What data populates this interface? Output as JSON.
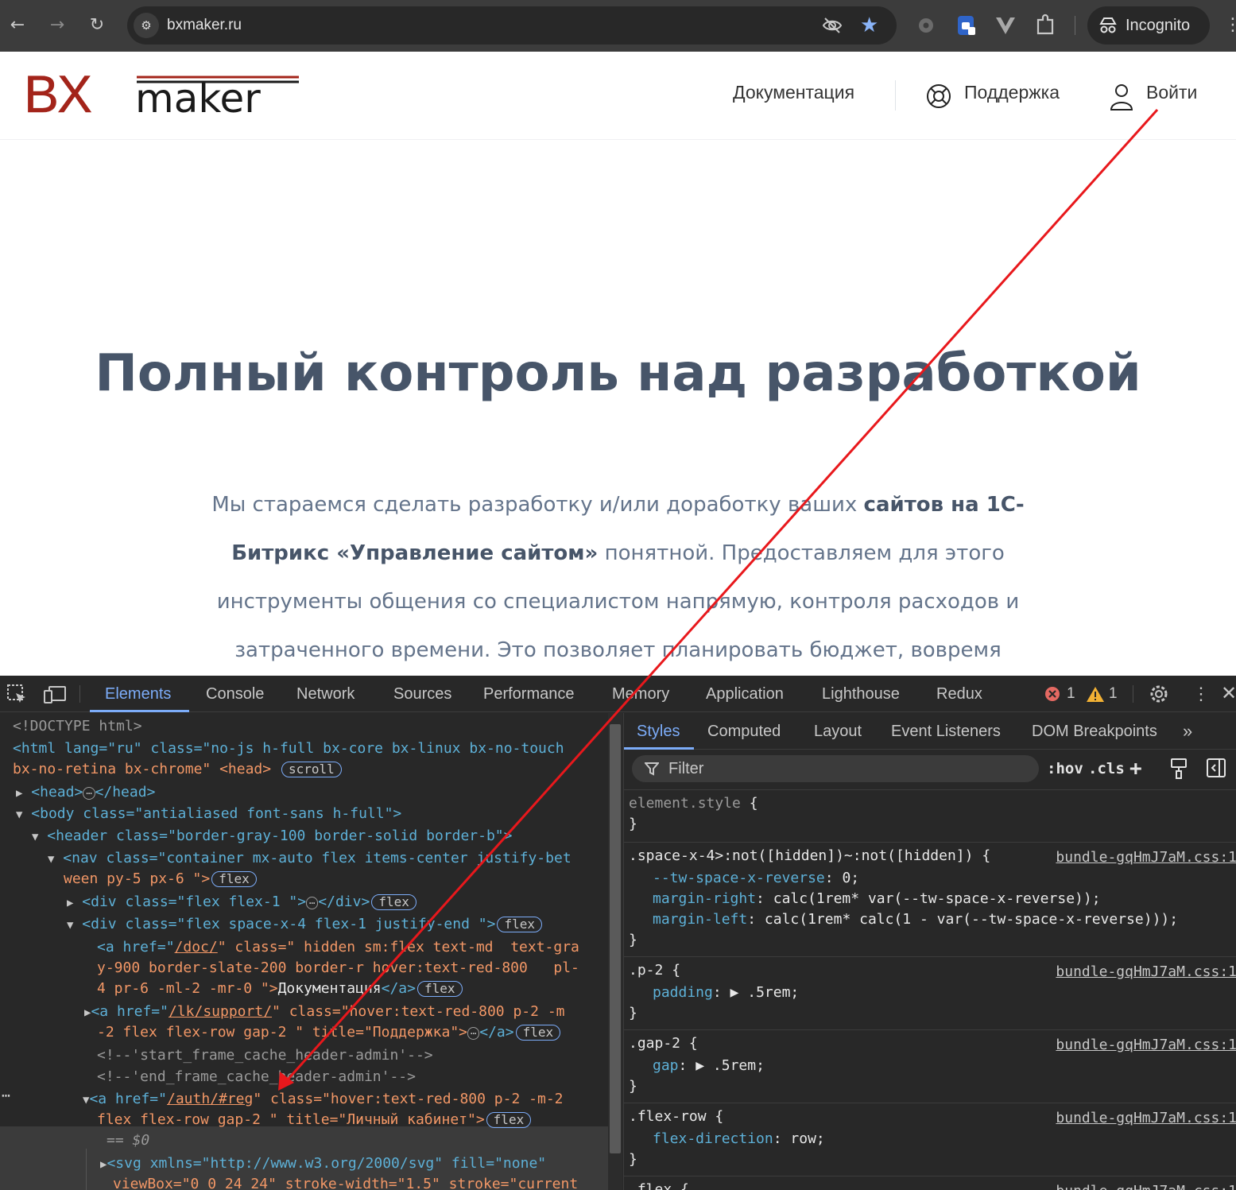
{
  "browser": {
    "url": "bxmaker.ru",
    "incognito_label": "Incognito",
    "icons": [
      "back-icon",
      "forward-icon",
      "reload-icon",
      "site-info-icon",
      "eye-off-icon",
      "bookmark-star-icon",
      "extension-gear-icon",
      "extension-shield-icon",
      "extension-vue-icon",
      "extensions-puzzle-icon",
      "incognito-icon",
      "menu-dots-icon"
    ]
  },
  "site": {
    "logo": {
      "part1": "BX",
      "part2": "maker"
    },
    "nav": {
      "docs": "Документация",
      "support": "Поддержка",
      "login": "Войти"
    },
    "hero_title": "Полный контроль над разработкой",
    "hero_text": {
      "p1": "Мы стараемся сделать разработку и/или доработку ваших ",
      "b1": "сайтов на 1С-Битрикс «Управление сайтом»",
      "p2": " понятной. Предоставляем для этого инструменты общения со специалистом напрямую, контроля расходов и затраченного времени. Это позволяет планировать бюджет, вовремя"
    },
    "colors": {
      "brand": "#a3241a",
      "heading": "#475569",
      "text": "#64748b"
    }
  },
  "devtools": {
    "tabs": [
      "Elements",
      "Console",
      "Network",
      "Sources",
      "Performance",
      "Memory",
      "Application",
      "Lighthouse",
      "Redux"
    ],
    "active_tab": "Elements",
    "errors": "1",
    "warnings": "1",
    "dom": [
      "<!DOCTYPE html>",
      "<html lang=\"ru\" class=\"no-js h-full bx-core bx-linux bx-no-touch",
      "bx-no-retina bx-chrome\" <head>",
      "<head>",
      "</head>",
      "<body class=\"antialiased font-sans h-full\">",
      "<header class=\"border-gray-100 border-solid border-b\">",
      "<nav class=\"container mx-auto flex items-center justify-bet",
      "ween py-5 px-6 \">",
      "<div class=\"flex flex-1 \">",
      "</div>",
      "<div class=\"flex space-x-4 flex-1 justify-end \">",
      "<a href=\"",
      "/doc/",
      "\" class=\" hidden sm:flex text-md  text-gra",
      "y-900 border-slate-200 border-r hover:text-red-800   pl-",
      "4 pr-6 -ml-2 -mr-0 \">",
      "Документация",
      "</a>",
      "/lk/support/",
      "\" class=\"hover:text-red-800 p-2 -m",
      "-2 flex flex-row gap-2 \" title=\"Поддержка\">",
      "<!--'start_frame_cache_header-admin'-->",
      "<!--'end_frame_cache_header-admin'-->",
      "/auth/#reg",
      "\" class=\"hover:text-red-800 p-2 -m-2",
      "flex flex-row gap-2 \" title=\"Личный кабинет\">",
      "== $0",
      "<svg xmlns=\"http://www.w3.org/2000/svg\" fill=\"none\"",
      "viewBox=\"0 0 24 24\" stroke-width=\"1.5\" stroke=\"current"
    ],
    "badges": {
      "scroll": "scroll",
      "flex": "flex",
      "ellipsis": "⋯"
    },
    "styles": {
      "tabs": [
        "Styles",
        "Computed",
        "Layout",
        "Event Listeners",
        "DOM Breakpoints"
      ],
      "active_tab": "Styles",
      "filter_placeholder": "Filter",
      "hov": ":hov",
      "cls": ".cls",
      "source": "bundle-gqHmJ7aM.css:1",
      "rules": {
        "element_selector": "element.style",
        "r1_selector": ".space-x-4>:not([hidden])~:not([hidden])",
        "r1_p1": "--tw-space-x-reverse",
        "r1_v1": "0",
        "r1_p2": "margin-right",
        "r1_v2": "calc(1rem* var(--tw-space-x-reverse));",
        "r1_p3": "margin-left",
        "r1_v3": "calc(1rem* calc(1 - var(--tw-space-x-reverse)));",
        "r2_selector": ".p-2",
        "r2_p": "padding",
        "r2_v": ".5rem;",
        "r3_selector": ".gap-2",
        "r3_p": "gap",
        "r3_v": ".5rem;",
        "r4_selector": ".flex-row",
        "r4_p": "flex-direction",
        "r4_v": "row;",
        "r5_selector": ".flex"
      }
    }
  },
  "annotation": {
    "color": "#e8181c"
  }
}
